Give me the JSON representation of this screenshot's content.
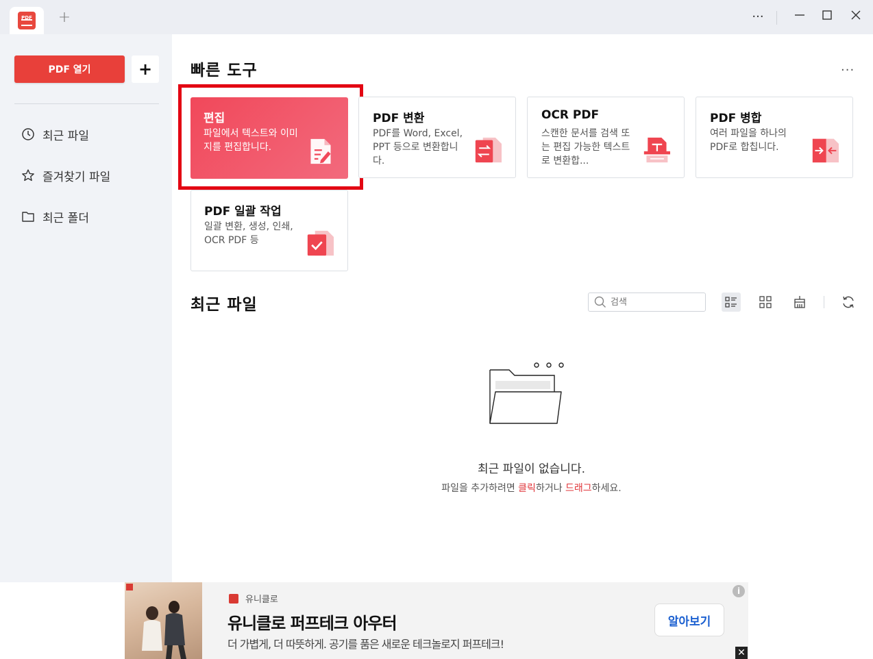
{
  "titlebar": {
    "logo_text": "PDF",
    "new_tab": "+",
    "more": "···",
    "minimize": "—",
    "maximize": "☐",
    "close": "✕"
  },
  "sidebar": {
    "open_button": "PDF 열기",
    "add_button": "+",
    "items": [
      {
        "label": "최근 파일",
        "icon": "clock-icon"
      },
      {
        "label": "즐겨찾기 파일",
        "icon": "star-icon"
      },
      {
        "label": "최근 폴더",
        "icon": "folder-icon"
      }
    ]
  },
  "quick_tools": {
    "title": "빠른 도구",
    "more": "···",
    "cards": [
      {
        "title": "편집",
        "desc": "파일에서 텍스트와 이미지를 편집합니다.",
        "icon": "edit-doc-icon"
      },
      {
        "title": "PDF 변환",
        "desc": "PDF를 Word, Excel, PPT 등으로 변환합니다.",
        "icon": "convert-icon"
      },
      {
        "title": "OCR PDF",
        "desc": "스캔한 문서를 검색 또는 편집 가능한 텍스트로 변환합...",
        "icon": "ocr-icon"
      },
      {
        "title": "PDF 병합",
        "desc": "여러 파일을 하나의 PDF로 합칩니다.",
        "icon": "merge-icon"
      },
      {
        "title": "PDF 일괄 작업",
        "desc": "일괄 변환, 생성, 인쇄, OCR PDF 등",
        "icon": "batch-icon"
      }
    ]
  },
  "recent": {
    "title": "최근 파일",
    "search_placeholder": "검색",
    "empty_title": "최근 파일이 없습니다.",
    "empty_sub_prefix": "파일을 추가하려면 ",
    "empty_sub_click": "클릭",
    "empty_sub_mid": "하거나 ",
    "empty_sub_drag": "드래그",
    "empty_sub_suffix": "하세요."
  },
  "ad": {
    "brand": "유니클로",
    "title": "유니클로 퍼프테크 아우터",
    "desc": "더 가볍게, 더 따뜻하게. 공기를 품은 새로운 테크놀로지 퍼프테크!",
    "cta": "알아보기",
    "info": "i",
    "close": "✕"
  },
  "colors": {
    "accent": "#e8403a",
    "edit_card": "#f1485a",
    "highlight": "#e30613"
  }
}
